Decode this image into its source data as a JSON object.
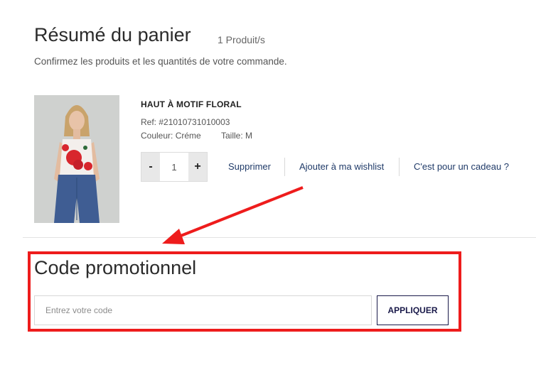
{
  "cart": {
    "title": "Résumé du panier",
    "count": "1 Produit/s",
    "subtitle": "Confirmez les produits et les quantités de votre commande."
  },
  "product": {
    "name": "HAUT À MOTIF FLORAL",
    "ref": "Ref: #21010731010003",
    "color": "Couleur: Créme",
    "size": "Taille: M",
    "quantity": "1",
    "minus_label": "-",
    "plus_label": "+",
    "actions": {
      "remove": "Supprimer",
      "wishlist": "Ajouter à ma wishlist",
      "gift": "C'est pour un cadeau ?"
    }
  },
  "promo": {
    "title": "Code promotionnel",
    "placeholder": "Entrez votre code",
    "apply_label": "APPLIQUER"
  },
  "colors": {
    "accent_link": "#1f3a68",
    "highlight_red": "#ee1c1c",
    "button_border": "#1a1a4a"
  }
}
